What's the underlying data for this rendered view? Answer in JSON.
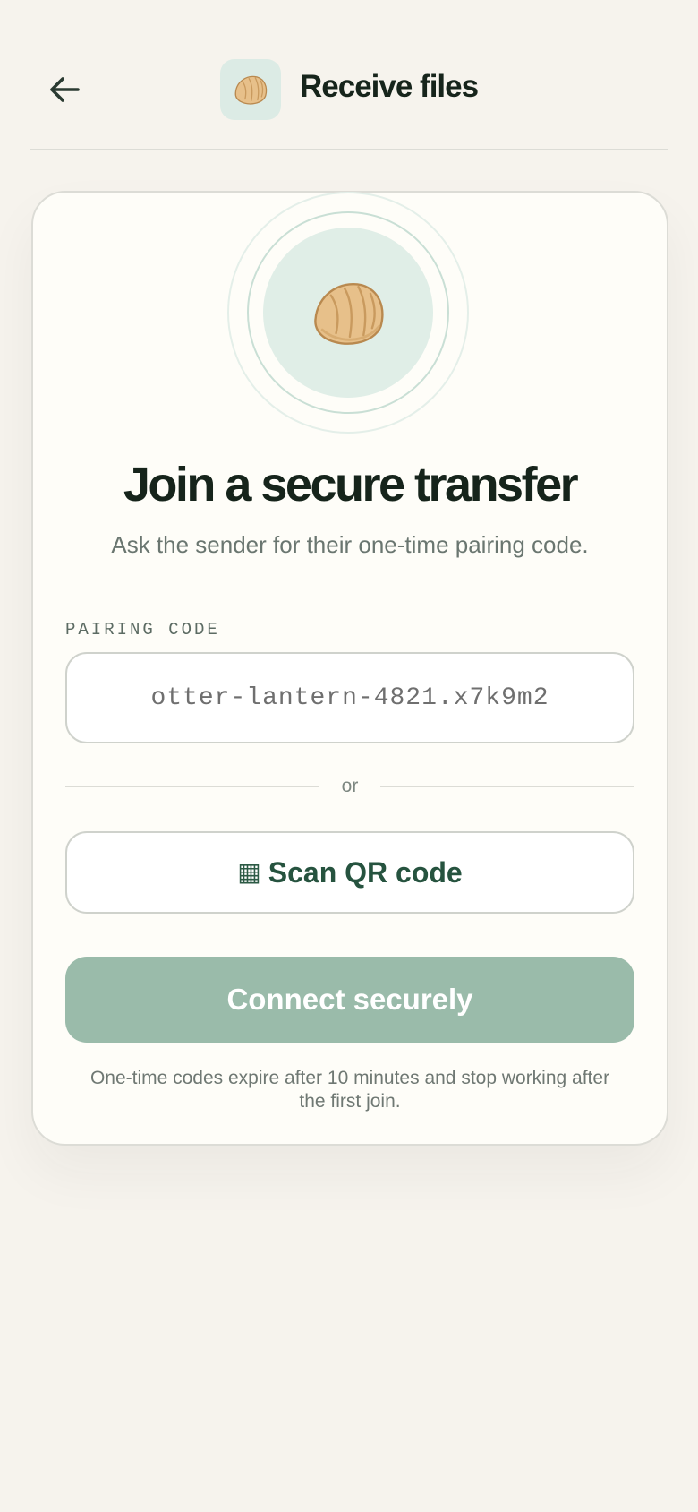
{
  "header": {
    "title": "Receive files",
    "back_icon": "arrow-left-icon",
    "app_icon": "dumpling-icon"
  },
  "card": {
    "hero_icon": "dumpling-icon",
    "title": "Join a secure transfer",
    "subtitle": "Ask the sender for their one-time pairing code.",
    "field_label": "PAIRING CODE",
    "code_placeholder": "otter-lantern-4821.x7k9m2",
    "code_value": "",
    "divider_text": "or",
    "scan_icon": "qr-code-icon",
    "scan_label": "Scan QR code",
    "connect_label": "Connect securely",
    "footnote": "One-time codes expire after 10 minutes and stop working after the first join."
  },
  "colors": {
    "background": "#f6f3ed",
    "card": "#fefdf8",
    "accent": "#26533f",
    "primary_button_disabled": "#9abbaa",
    "icon_tile": "#dcebe5"
  }
}
